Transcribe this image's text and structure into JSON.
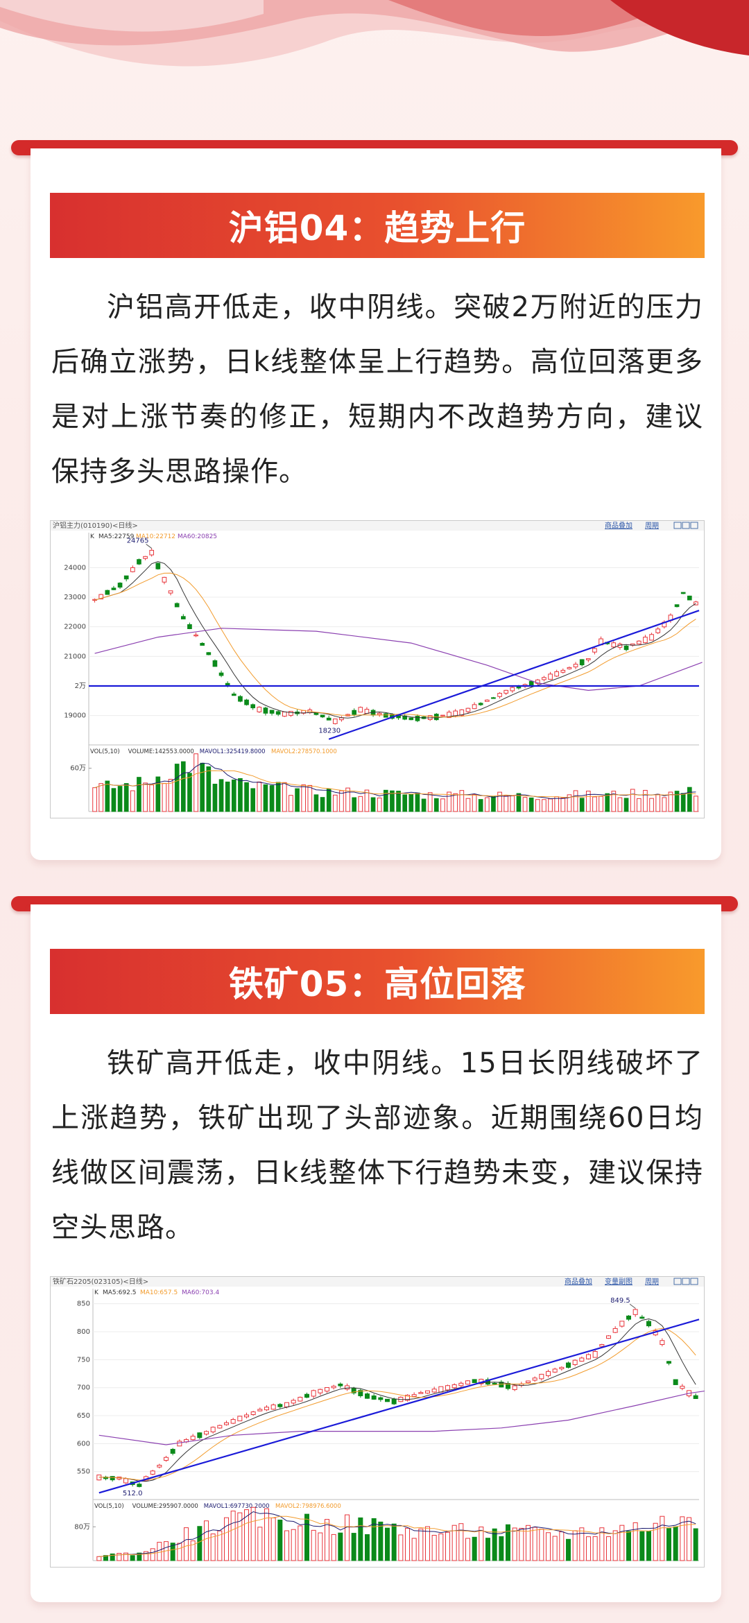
{
  "cards": [
    {
      "banner": "沪铝04：趋势上行",
      "body": "沪铝高开低走，收中阴线。突破2万附近的压力后确立涨势，日k线整体呈上行趋势。高位回落更多是对上涨节奏的修正，短期内不改趋势方向，建议保持多头思路操作。"
    },
    {
      "banner": "铁矿05：高位回落",
      "body": "铁矿高开低走，收中阴线。15日长阴线破坏了上涨趋势，铁矿出现了头部迹象。近期围绕60日均线做区间震荡，日k线整体下行趋势未变，建议保持空头思路。"
    }
  ],
  "chart_data": [
    {
      "type": "candlestick",
      "title": "沪铝主力(010190)<日线>",
      "toolbar": [
        "商品叠加",
        "周期"
      ],
      "ma_legend": {
        "k": "K",
        "ma5": "MA5:22759",
        "ma10": "MA10:22712",
        "ma60": "MA60:20825"
      },
      "vol_legend": {
        "vol": "VOL(5,10)",
        "volume": "VOLUME:142553.0000",
        "mavol1": "MAVOL1:325419.8000",
        "mavol2": "MAVOL2:278570.1000"
      },
      "y_ticks": [
        "24000",
        "23000",
        "22000",
        "21000",
        "2万",
        "19000"
      ],
      "y_tick_values": [
        24000,
        23000,
        22000,
        21000,
        20000,
        19000
      ],
      "ylim": [
        18100,
        24900
      ],
      "vol_tick": "60万",
      "vol_tick_value": 600000,
      "vol_max": 750000,
      "annotations": {
        "high": "24765",
        "low": "18230"
      },
      "candle_count": 96,
      "anchors": [
        [
          0,
          22900
        ],
        [
          4,
          23400
        ],
        [
          7,
          24200
        ],
        [
          9,
          24500
        ],
        [
          11,
          23600
        ],
        [
          14,
          22300
        ],
        [
          18,
          21100
        ],
        [
          22,
          19700
        ],
        [
          26,
          19200
        ],
        [
          30,
          19050
        ],
        [
          34,
          19150
        ],
        [
          38,
          18800
        ],
        [
          42,
          19200
        ],
        [
          46,
          19000
        ],
        [
          50,
          18900
        ],
        [
          54,
          18950
        ],
        [
          58,
          19100
        ],
        [
          62,
          19500
        ],
        [
          66,
          19900
        ],
        [
          70,
          20150
        ],
        [
          74,
          20500
        ],
        [
          78,
          20900
        ],
        [
          80,
          21500
        ],
        [
          84,
          21300
        ],
        [
          88,
          21650
        ],
        [
          91,
          22300
        ],
        [
          93,
          23150
        ],
        [
          95,
          22800
        ],
        [
          96,
          22600
        ]
      ],
      "volume_anchors": [
        [
          0,
          320000
        ],
        [
          8,
          400000
        ],
        [
          12,
          600000
        ],
        [
          16,
          700000
        ],
        [
          19,
          430000
        ],
        [
          25,
          350000
        ],
        [
          35,
          280000
        ],
        [
          50,
          240000
        ],
        [
          65,
          220000
        ],
        [
          80,
          230000
        ],
        [
          96,
          280000
        ]
      ],
      "lines": {
        "support": {
          "from": [
            37,
            18200
          ],
          "to": [
            96,
            22550
          ]
        },
        "horizontal": {
          "y": 20000
        },
        "ma60_points": [
          [
            0,
            21100
          ],
          [
            10,
            21650
          ],
          [
            20,
            21950
          ],
          [
            35,
            21850
          ],
          [
            50,
            21450
          ],
          [
            62,
            20700
          ],
          [
            70,
            20100
          ],
          [
            78,
            19850
          ],
          [
            86,
            20000
          ],
          [
            96,
            20800
          ]
        ]
      },
      "colors": {
        "up": "#e8343a",
        "down": "#0b8a1a",
        "ma5": "#333333",
        "ma10": "#f29b2c",
        "ma60": "#8a3fb0",
        "trend": "#1a1ad8"
      }
    },
    {
      "type": "candlestick",
      "title": "铁矿石2205(023105)<日线>",
      "toolbar": [
        "商品叠加",
        "变量副图",
        "周期"
      ],
      "ma_legend": {
        "k": "K",
        "ma5": "MA5:692.5",
        "ma10": "MA10:657.5",
        "ma60": "MA60:703.4"
      },
      "vol_legend": {
        "vol": "VOL(5,10)",
        "volume": "VOLUME:295907.0000",
        "mavol1": "MAVOL1:697730.2000",
        "mavol2": "MAVOL2:798976.6000"
      },
      "y_ticks": [
        "850",
        "800",
        "750",
        "700",
        "650",
        "600",
        "550"
      ],
      "y_tick_values": [
        850,
        800,
        750,
        700,
        650,
        600,
        550
      ],
      "ylim": [
        505,
        862
      ],
      "vol_tick": "80万",
      "vol_tick_value": 800000,
      "vol_max": 1150000,
      "annotations": {
        "high": "849.5",
        "low": "512.0"
      },
      "candle_count": 90,
      "anchors": [
        [
          0,
          540
        ],
        [
          3,
          538
        ],
        [
          6,
          525
        ],
        [
          9,
          560
        ],
        [
          12,
          600
        ],
        [
          16,
          620
        ],
        [
          20,
          640
        ],
        [
          24,
          660
        ],
        [
          28,
          670
        ],
        [
          32,
          690
        ],
        [
          36,
          705
        ],
        [
          40,
          685
        ],
        [
          44,
          675
        ],
        [
          48,
          690
        ],
        [
          52,
          700
        ],
        [
          56,
          712
        ],
        [
          58,
          710
        ],
        [
          62,
          700
        ],
        [
          66,
          720
        ],
        [
          70,
          740
        ],
        [
          74,
          760
        ],
        [
          76,
          790
        ],
        [
          78,
          815
        ],
        [
          80,
          835
        ],
        [
          82,
          815
        ],
        [
          84,
          780
        ],
        [
          86,
          710
        ],
        [
          88,
          690
        ],
        [
          90,
          675
        ],
        [
          92,
          690
        ],
        [
          94,
          705
        ],
        [
          95,
          685
        ]
      ],
      "volume_anchors": [
        [
          0,
          120000
        ],
        [
          6,
          180000
        ],
        [
          12,
          560000
        ],
        [
          18,
          880000
        ],
        [
          24,
          1000000
        ],
        [
          30,
          900000
        ],
        [
          40,
          830000
        ],
        [
          50,
          690000
        ],
        [
          60,
          680000
        ],
        [
          70,
          650000
        ],
        [
          80,
          800000
        ],
        [
          86,
          960000
        ],
        [
          95,
          700000
        ]
      ],
      "lines": {
        "support": {
          "from": [
            0,
            512
          ],
          "to": [
            95,
            822
          ]
        },
        "ma60_points": [
          [
            0,
            615
          ],
          [
            10,
            598
          ],
          [
            20,
            615
          ],
          [
            30,
            622
          ],
          [
            40,
            622
          ],
          [
            50,
            622
          ],
          [
            60,
            628
          ],
          [
            70,
            642
          ],
          [
            80,
            668
          ],
          [
            88,
            690
          ],
          [
            95,
            702
          ]
        ]
      },
      "colors": {
        "up": "#e8343a",
        "down": "#0b8a1a",
        "ma5": "#333333",
        "ma10": "#f29b2c",
        "ma60": "#8a3fb0",
        "trend": "#1a1ad8"
      }
    }
  ]
}
